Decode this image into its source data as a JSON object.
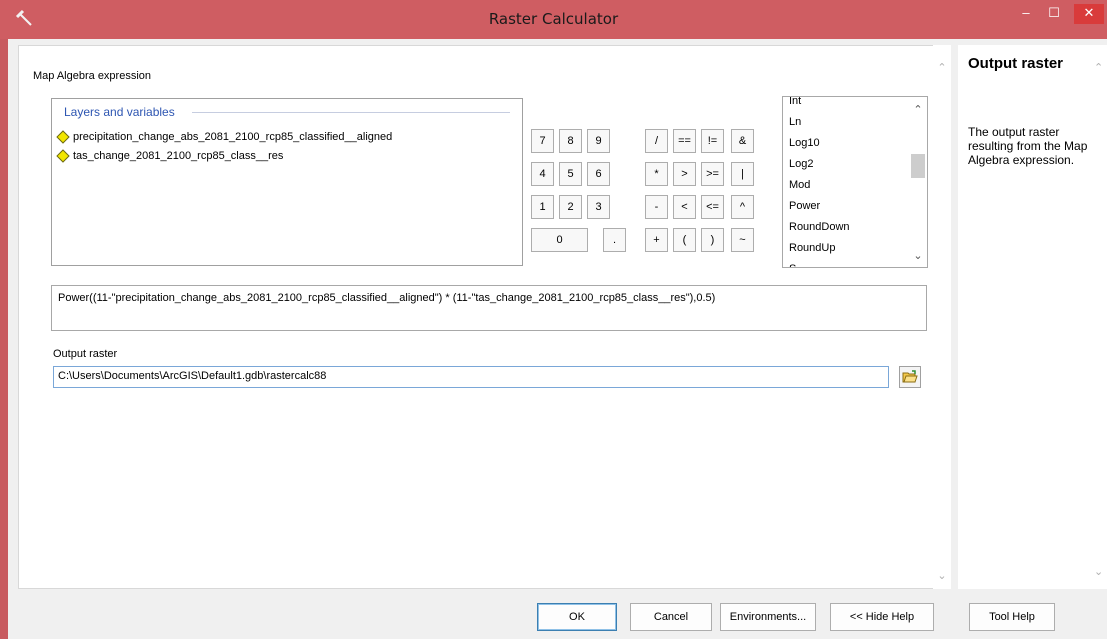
{
  "window": {
    "title": "Raster Calculator",
    "minimize_glyph": "‒",
    "maximize_glyph": "☐",
    "close_glyph": "✕"
  },
  "colors": {
    "titlebar": "#cf5d62",
    "close_button": "#d93b3b",
    "layers_header": "#2e56b2",
    "layer_diamond": "#f2e600"
  },
  "main": {
    "expression_label": "Map Algebra expression",
    "layers_header": "Layers and variables",
    "layers": [
      {
        "name": "precipitation_change_abs_2081_2100_rcp85_classified__aligned",
        "icon": "raster-layer-icon"
      },
      {
        "name": "tas_change_2081_2100_rcp85_class__res",
        "icon": "raster-layer-icon"
      }
    ],
    "calc_buttons": {
      "row1": [
        "7",
        "8",
        "9",
        "/",
        "==",
        "!=",
        "&"
      ],
      "row2": [
        "4",
        "5",
        "6",
        "*",
        ">",
        ">=",
        "|"
      ],
      "row3": [
        "1",
        "2",
        "3",
        "-",
        "<",
        "<=",
        "^"
      ],
      "row4": [
        "0",
        ".",
        "+",
        "(",
        ")",
        "~"
      ]
    },
    "functions": [
      "Int",
      "Ln",
      "Log10",
      "Log2",
      "Mod",
      "Power",
      "RoundDown",
      "RoundUp",
      "S..."
    ],
    "expression": "Power((11-\"precipitation_change_abs_2081_2100_rcp85_classified__aligned\") * (11-\"tas_change_2081_2100_rcp85_class__res\"),0.5)",
    "output_label": "Output raster",
    "output_value": "C:\\Users\\Documents\\ArcGIS\\Default1.gdb\\rastercalc88"
  },
  "buttons": {
    "ok": "OK",
    "cancel": "Cancel",
    "environments": "Environments...",
    "hide_help": "<< Hide Help",
    "tool_help": "Tool Help"
  },
  "help": {
    "title": "Output raster",
    "text": "The output raster resulting from the Map Algebra expression."
  }
}
